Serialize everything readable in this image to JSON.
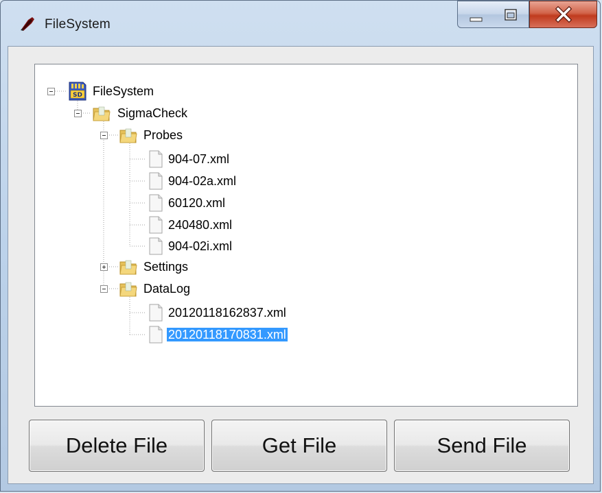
{
  "window": {
    "title": "FileSystem"
  },
  "tree": {
    "root": "FileSystem",
    "folder": "SigmaCheck",
    "probes": "Probes",
    "probe_files": [
      "904-07.xml",
      "904-02a.xml",
      "60120.xml",
      "240480.xml",
      "904-02i.xml"
    ],
    "settings": "Settings",
    "datalog": "DataLog",
    "datalog_files": [
      "20120118162837.xml",
      "20120118170831.xml"
    ],
    "selected": "20120118170831.xml"
  },
  "buttons": {
    "delete": "Delete File",
    "get": "Get File",
    "send": "Send File"
  },
  "colors": {
    "selection": "#3399ff"
  }
}
